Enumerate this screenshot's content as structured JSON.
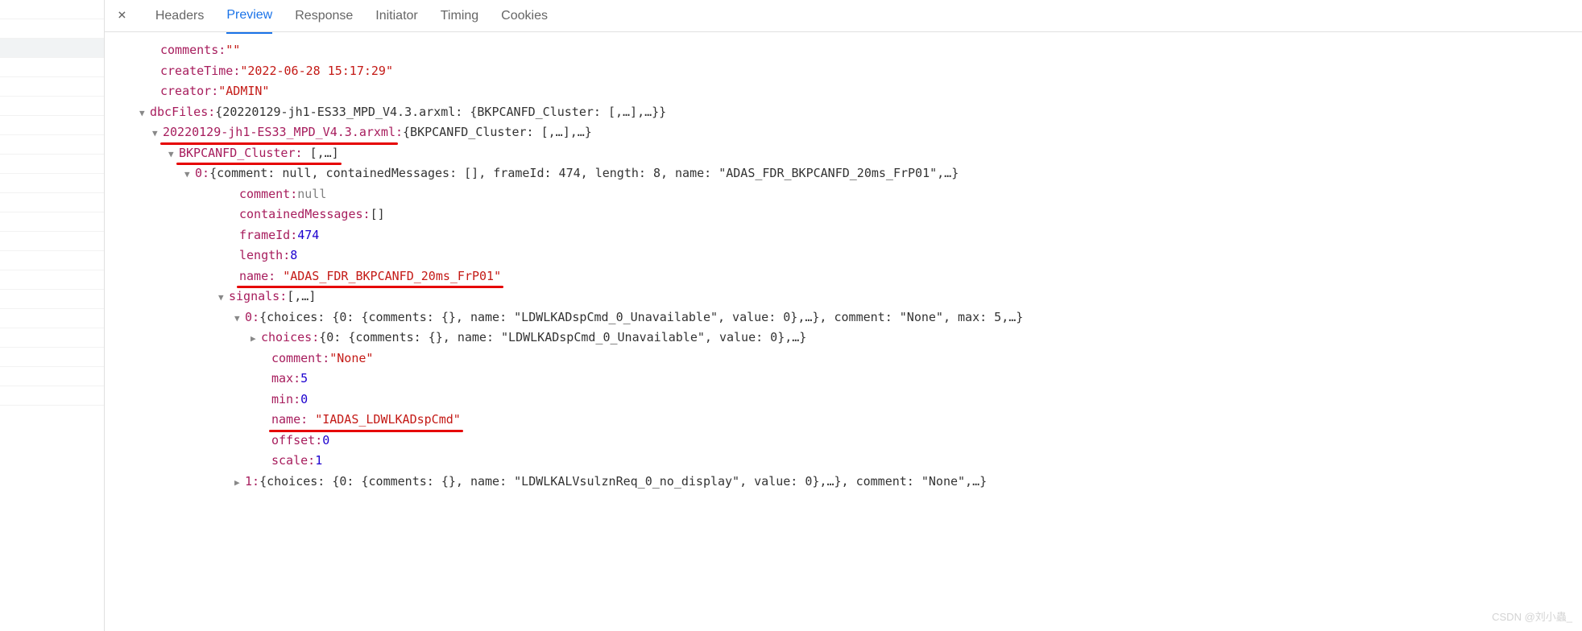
{
  "tabs": {
    "headers": "Headers",
    "preview": "Preview",
    "response": "Response",
    "initiator": "Initiator",
    "timing": "Timing",
    "cookies": "Cookies"
  },
  "json": {
    "comments_key": "comments",
    "comments_val": "\"\"",
    "createTime_key": "createTime",
    "createTime_val": "\"2022-06-28 15:17:29\"",
    "creator_key": "creator",
    "creator_val": "\"ADMIN\"",
    "dbcFiles_key": "dbcFiles",
    "dbcFiles_summary": "{20220129-jh1-ES33_MPD_V4.3.arxml: {BKPCANFD_Cluster: [,…],…}}",
    "file_key": "20220129-jh1-ES33_MPD_V4.3.arxml",
    "file_summary": "{BKPCANFD_Cluster: [,…],…}",
    "cluster_key": "BKPCANFD_Cluster",
    "cluster_summary": "[,…]",
    "idx0_key": "0",
    "idx0_summary": "{comment: null, containedMessages: [], frameId: 474, length: 8, name: \"ADAS_FDR_BKPCANFD_20ms_FrP01\",…}",
    "comment_key": "comment",
    "comment_val": "null",
    "containedMessages_key": "containedMessages",
    "containedMessages_val": "[]",
    "frameId_key": "frameId",
    "frameId_val": "474",
    "length_key": "length",
    "length_val": "8",
    "name_key": "name",
    "name_val": "\"ADAS_FDR_BKPCANFD_20ms_FrP01\"",
    "signals_key": "signals",
    "signals_summary": "[,…]",
    "sig0_key": "0",
    "sig0_summary": "{choices: {0: {comments: {}, name: \"LDWLKADspCmd_0_Unavailable\", value: 0},…}, comment: \"None\", max: 5,…}",
    "choices_key": "choices",
    "choices_summary": "{0: {comments: {}, name: \"LDWLKADspCmd_0_Unavailable\", value: 0},…}",
    "sig_comment_key": "comment",
    "sig_comment_val": "\"None\"",
    "max_key": "max",
    "max_val": "5",
    "min_key": "min",
    "min_val": "0",
    "sig_name_key": "name",
    "sig_name_val": "\"IADAS_LDWLKADspCmd\"",
    "offset_key": "offset",
    "offset_val": "0",
    "scale_key": "scale",
    "scale_val": "1",
    "sig1_key": "1",
    "sig1_summary": "{choices: {0: {comments: {}, name: \"LDWLKALVsulznReq_0_no_display\", value: 0},…}, comment: \"None\",…}"
  },
  "watermark": "CSDN @刘小蟲_"
}
